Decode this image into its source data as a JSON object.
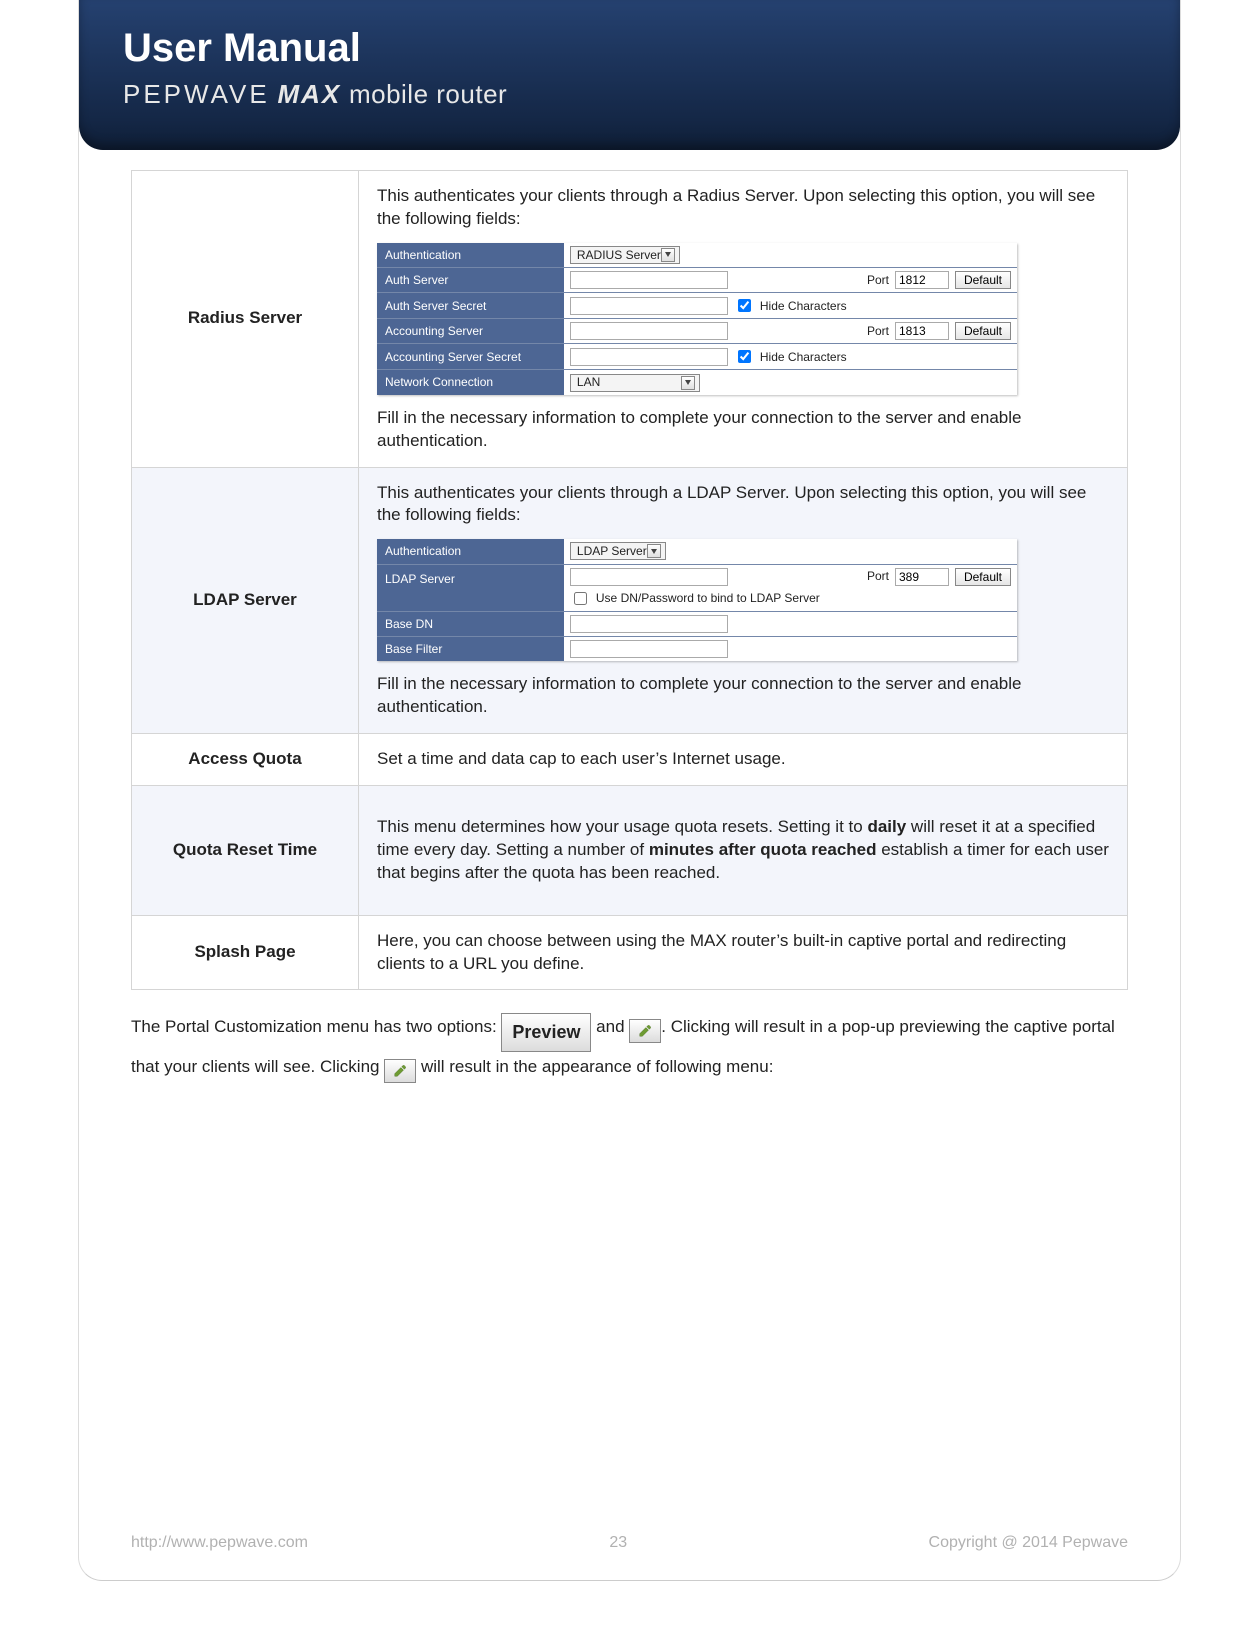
{
  "header": {
    "title": "User Manual",
    "brand": "PEPWAVE",
    "product_bold": "MAX",
    "product_light": "mobile router"
  },
  "table": {
    "radius": {
      "label": "Radius Server",
      "intro": "This authenticates your clients through a Radius Server. Upon selecting this option, you will see the following fields:",
      "outro": "Fill in the necessary information to complete your connection to the server and enable authentication.",
      "rows": {
        "authentication_label": "Authentication",
        "authentication_value": "RADIUS Server",
        "auth_server_label": "Auth Server",
        "auth_server_port_label": "Port",
        "auth_server_port_value": "1812",
        "default_btn": "Default",
        "auth_secret_label": "Auth Server Secret",
        "hide_chars_label": "Hide Characters",
        "acct_server_label": "Accounting Server",
        "acct_server_port_value": "1813",
        "acct_secret_label": "Accounting Server Secret",
        "net_conn_label": "Network Connection",
        "net_conn_value": "LAN"
      }
    },
    "ldap": {
      "label": "LDAP Server",
      "intro": "This authenticates your clients through a LDAP Server. Upon selecting this option, you will see the following fields:",
      "outro": "Fill in the necessary information to complete your connection to the server and enable authentication.",
      "rows": {
        "authentication_label": "Authentication",
        "authentication_value": "LDAP Server",
        "ldap_server_label": "LDAP Server",
        "port_label": "Port",
        "port_value": "389",
        "default_btn": "Default",
        "use_dn_label": "Use DN/Password to bind to LDAP Server",
        "base_dn_label": "Base DN",
        "base_filter_label": "Base Filter"
      }
    },
    "access_quota": {
      "label": "Access Quota",
      "text": "Set a time and data cap to each user’s Internet usage."
    },
    "quota_reset": {
      "label": "Quota Reset Time",
      "text_pre": "This menu determines how your usage quota resets. Setting it to ",
      "bold1": "daily",
      "text_mid": " will reset it at a specified time every day. Setting a number of ",
      "bold2": "minutes after quota reached",
      "text_post": " establish a timer for each user that begins after the quota has been reached."
    },
    "splash": {
      "label": "Splash Page",
      "text": "Here, you can choose between using the MAX router’s built-in captive portal and redirecting clients to a URL you define."
    }
  },
  "para": {
    "pre": "The Portal Customization menu has two options: ",
    "preview_label": "Preview",
    "and": " and ",
    "after_icon": ". Clicking will result in a pop-up previewing the captive portal that your clients will see. Clicking ",
    "tail": " will result in the appearance of following menu:"
  },
  "footer": {
    "url": "http://www.pepwave.com",
    "page": "23",
    "copyright": "Copyright @ 2014 Pepwave"
  }
}
